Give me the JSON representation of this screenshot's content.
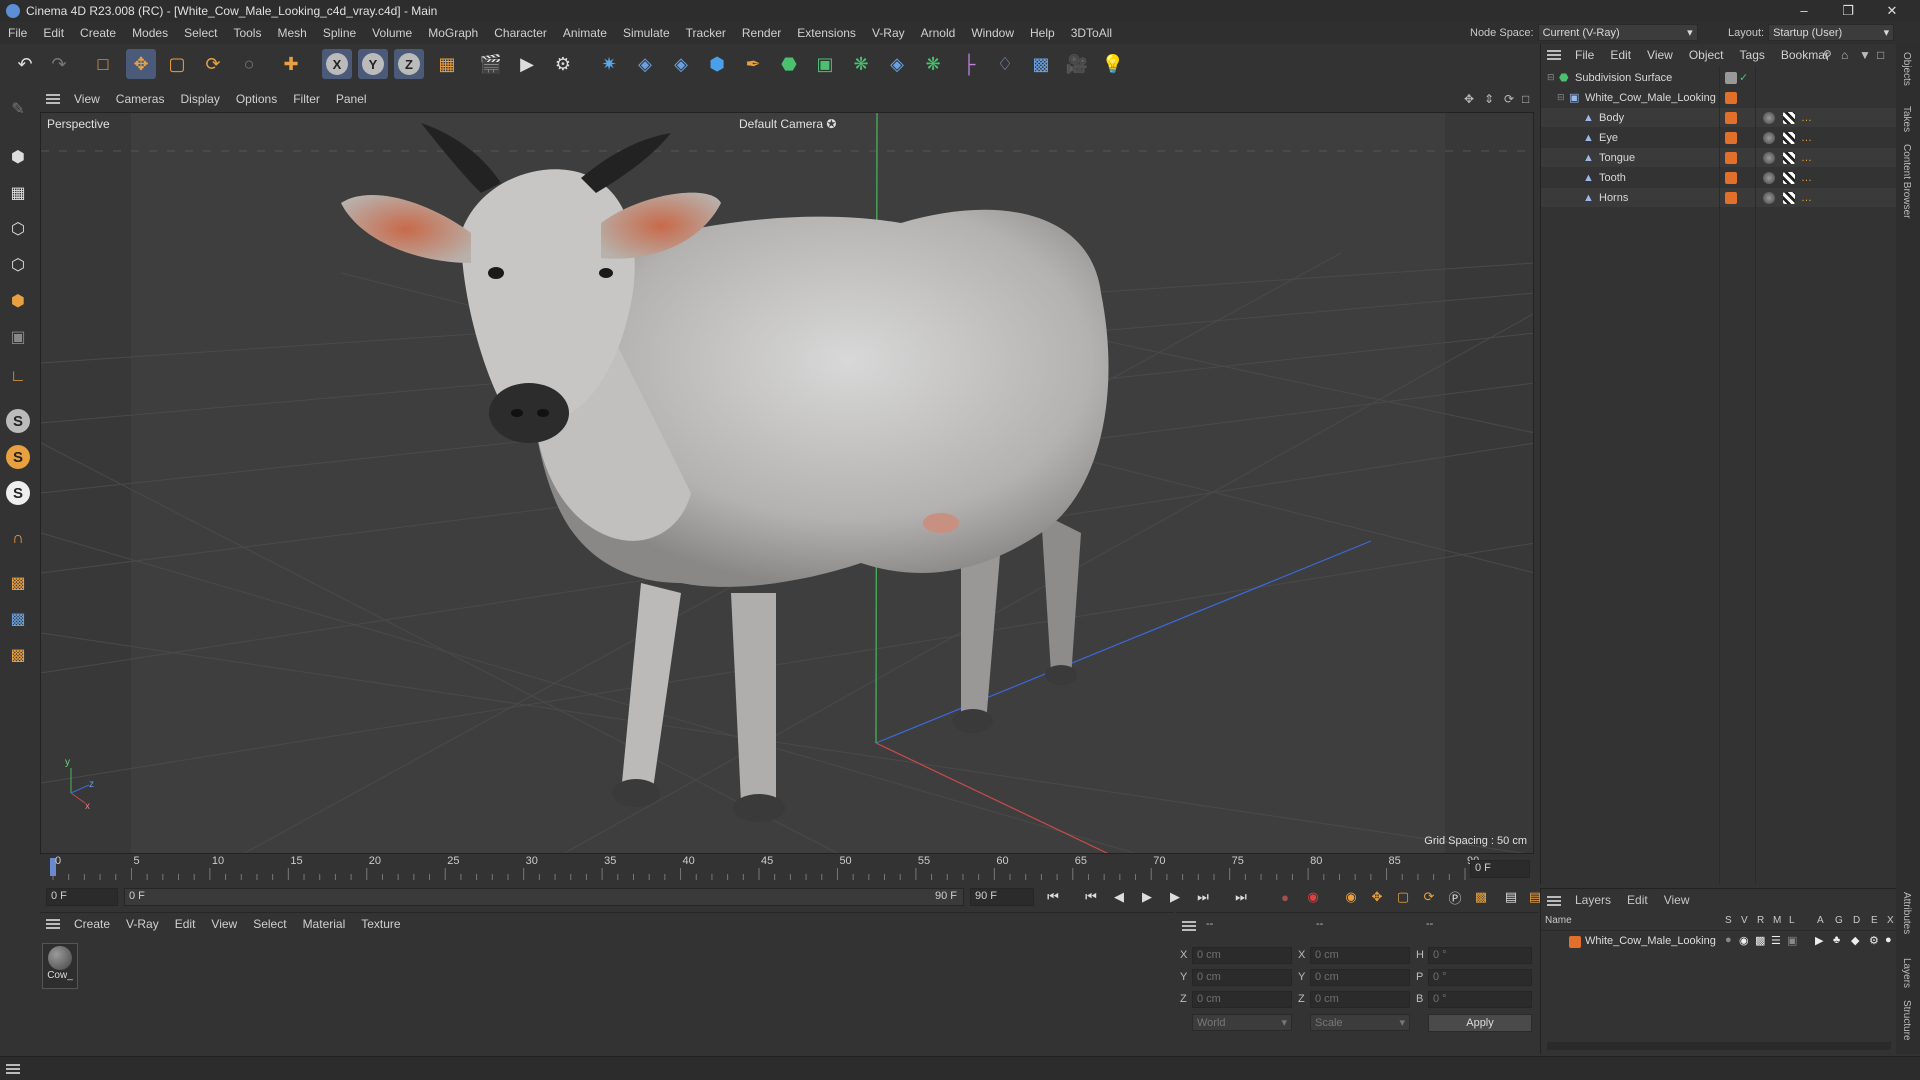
{
  "window": {
    "title": "Cinema 4D R23.008 (RC) - [White_Cow_Male_Looking_c4d_vray.c4d] - Main"
  },
  "menu": [
    "File",
    "Edit",
    "Create",
    "Modes",
    "Select",
    "Tools",
    "Mesh",
    "Spline",
    "Volume",
    "MoGraph",
    "Character",
    "Animate",
    "Simulate",
    "Tracker",
    "Render",
    "Extensions",
    "V-Ray",
    "Arnold",
    "Window",
    "Help",
    "3DToAll"
  ],
  "node_space": {
    "label": "Node Space:",
    "value": "Current (V-Ray)"
  },
  "layout": {
    "label": "Layout:",
    "value": "Startup (User)"
  },
  "toolbar_axes": [
    "X",
    "Y",
    "Z"
  ],
  "left_tool_balls": [
    "S",
    "S",
    "S"
  ],
  "viewport_menu": [
    "View",
    "Cameras",
    "Display",
    "Options",
    "Filter",
    "Panel"
  ],
  "viewport": {
    "label": "Perspective",
    "camera": "Default Camera",
    "grid_spacing": "Grid Spacing : 50 cm"
  },
  "timeline": {
    "ticks": [
      "0",
      "5",
      "10",
      "15",
      "20",
      "25",
      "30",
      "35",
      "40",
      "45",
      "50",
      "55",
      "60",
      "65",
      "70",
      "75",
      "80",
      "85",
      "90"
    ],
    "current_frame": "0 F"
  },
  "transport": {
    "start_field": "0 F",
    "range_start": "0 F",
    "range_end": "90 F",
    "end_field": "90 F"
  },
  "material_menu": [
    "Create",
    "V-Ray",
    "Edit",
    "View",
    "Select",
    "Material",
    "Texture"
  ],
  "materials": [
    {
      "name": "Cow_"
    }
  ],
  "coordinates": {
    "header_dashes": [
      "--",
      "--",
      "--"
    ],
    "rows": [
      {
        "pos_label": "X",
        "pos": "0 cm",
        "size_label": "X",
        "size": "0 cm",
        "rot_label": "H",
        "rot": "0 °"
      },
      {
        "pos_label": "Y",
        "pos": "0 cm",
        "size_label": "Y",
        "size": "0 cm",
        "rot_label": "P",
        "rot": "0 °"
      },
      {
        "pos_label": "Z",
        "pos": "0 cm",
        "size_label": "Z",
        "size": "0 cm",
        "rot_label": "B",
        "rot": "0 °"
      }
    ],
    "world_dropdown": "World",
    "scale_dropdown": "Scale",
    "apply": "Apply"
  },
  "objects_menu": [
    "File",
    "Edit",
    "View",
    "Object",
    "Tags",
    "Bookmar"
  ],
  "objects": [
    {
      "name": "Subdivision Surface",
      "indent": 0
    },
    {
      "name": "White_Cow_Male_Looking",
      "indent": 1
    },
    {
      "name": "Body",
      "indent": 2
    },
    {
      "name": "Eye",
      "indent": 2
    },
    {
      "name": "Tongue",
      "indent": 2
    },
    {
      "name": "Tooth",
      "indent": 2
    },
    {
      "name": "Horns",
      "indent": 2
    }
  ],
  "layers_menu": [
    "Layers",
    "Edit",
    "View"
  ],
  "layers_header": {
    "name": "Name",
    "cols": [
      "S",
      "V",
      "R",
      "M",
      "L",
      "A",
      "G",
      "D",
      "E",
      "X"
    ]
  },
  "layers": [
    {
      "name": "White_Cow_Male_Looking"
    }
  ],
  "side_tabs": [
    "Objects",
    "Takes",
    "Content Browser",
    "Attributes",
    "Layers",
    "Structure"
  ],
  "colors": {
    "accent_orange": "#e0702a",
    "selection_blue": "#4a5a78",
    "x_axis": "#c84a4a",
    "y_axis": "#4ab85a",
    "z_axis": "#3a6ad8"
  }
}
